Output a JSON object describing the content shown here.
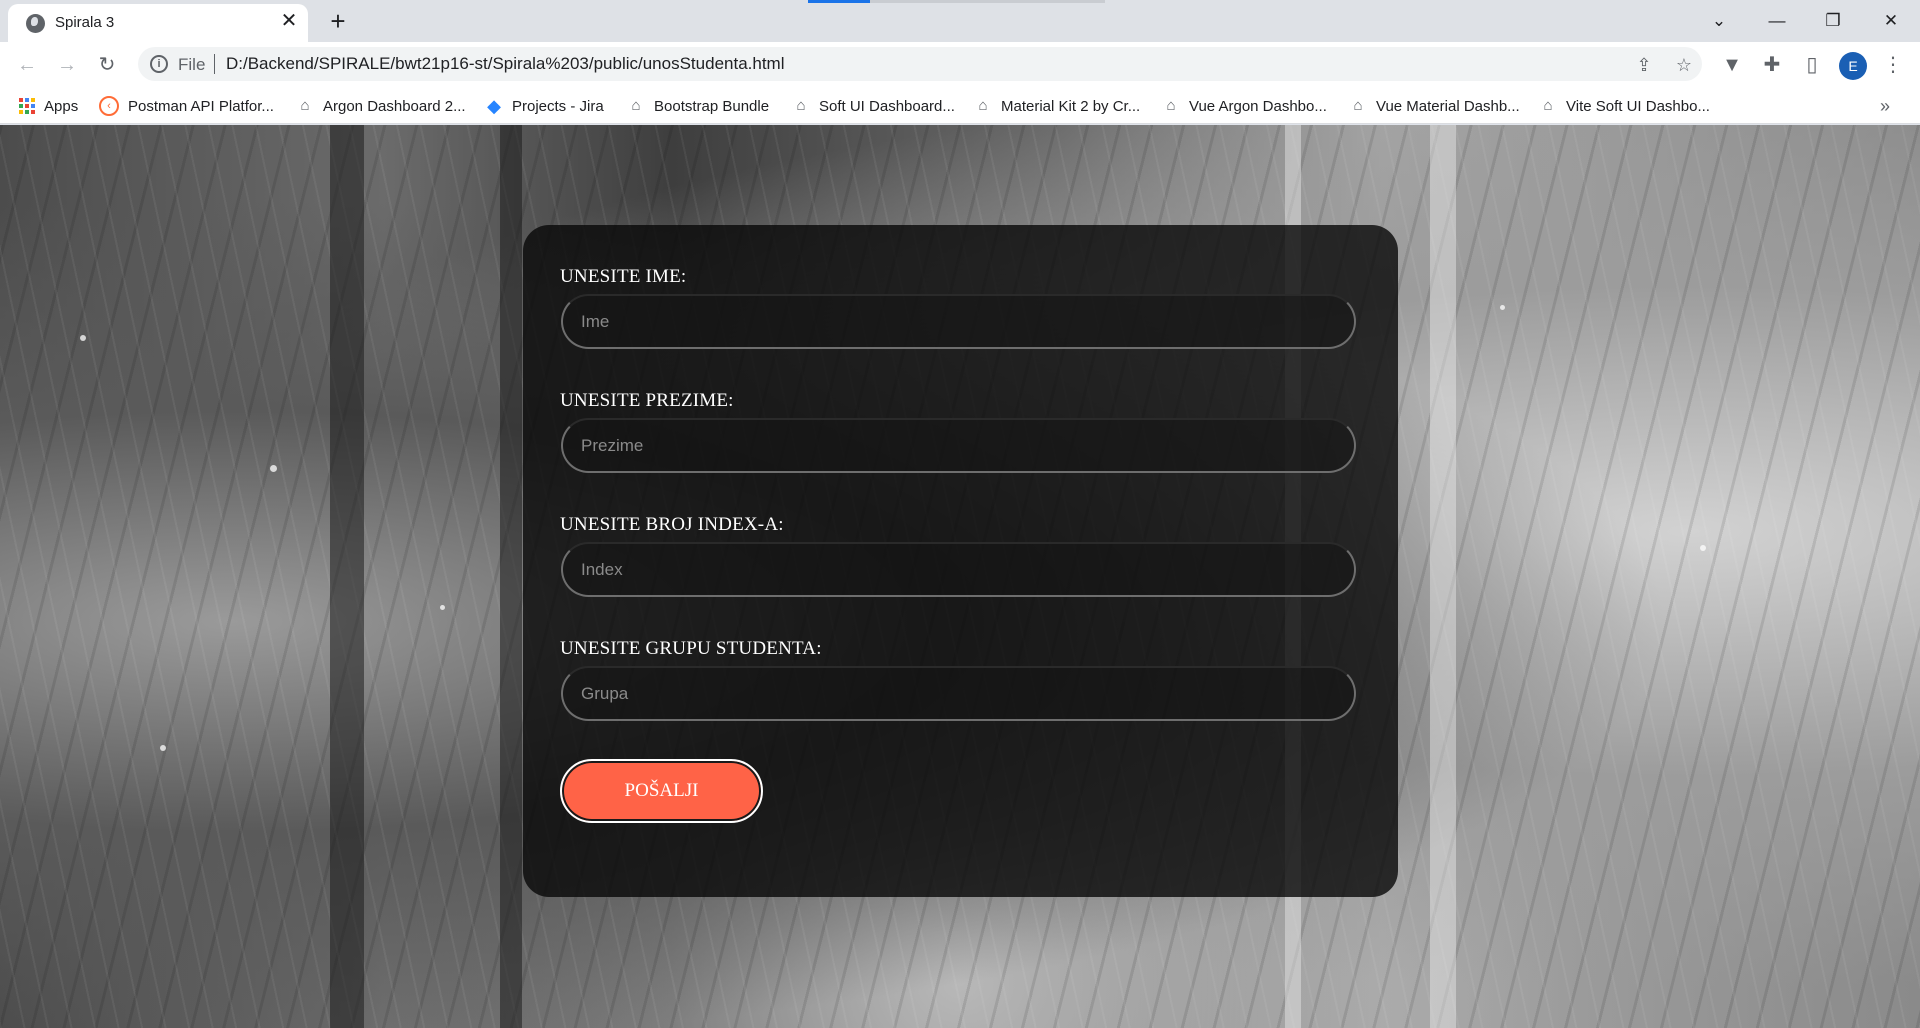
{
  "browser": {
    "tab_title": "Spirala 3",
    "tab_close": "✕",
    "new_tab": "+",
    "address_scheme_label": "File",
    "address_url": "D:/Backend/SPIRALE/bwt21p16-st/Spirala%203/public/unosStudenta.html",
    "profile_initial": "E",
    "window_controls": [
      "⌄",
      "—",
      "❐",
      "✕"
    ]
  },
  "bookmarks": [
    {
      "label": "Apps",
      "icon": "apps-grid-icon"
    },
    {
      "label": "Postman API Platfor...",
      "icon": "postman-icon"
    },
    {
      "label": "Argon Dashboard 2...",
      "icon": "template-icon"
    },
    {
      "label": "Projects - Jira",
      "icon": "jira-icon"
    },
    {
      "label": "Bootstrap Bundle",
      "icon": "template-icon"
    },
    {
      "label": "Soft UI Dashboard...",
      "icon": "template-icon"
    },
    {
      "label": "Material Kit 2 by Cr...",
      "icon": "template-icon"
    },
    {
      "label": "Vue Argon Dashbo...",
      "icon": "template-icon"
    },
    {
      "label": "Vue Material Dashb...",
      "icon": "template-icon"
    },
    {
      "label": "Vite Soft UI Dashbo...",
      "icon": "template-icon"
    }
  ],
  "form": {
    "fields": [
      {
        "label": "UNESITE IME:",
        "placeholder": "Ime",
        "value": ""
      },
      {
        "label": "UNESITE PREZIME:",
        "placeholder": "Prezime",
        "value": ""
      },
      {
        "label": "UNESITE BROJ INDEX-A:",
        "placeholder": "Index",
        "value": ""
      },
      {
        "label": "UNESITE GRUPU STUDENTA:",
        "placeholder": "Grupa",
        "value": ""
      }
    ],
    "submit_label": "POŠALJI"
  },
  "colors": {
    "submit_button": "#ff6347",
    "card_background": "#080808",
    "profile_avatar": "#1a5fb4"
  }
}
